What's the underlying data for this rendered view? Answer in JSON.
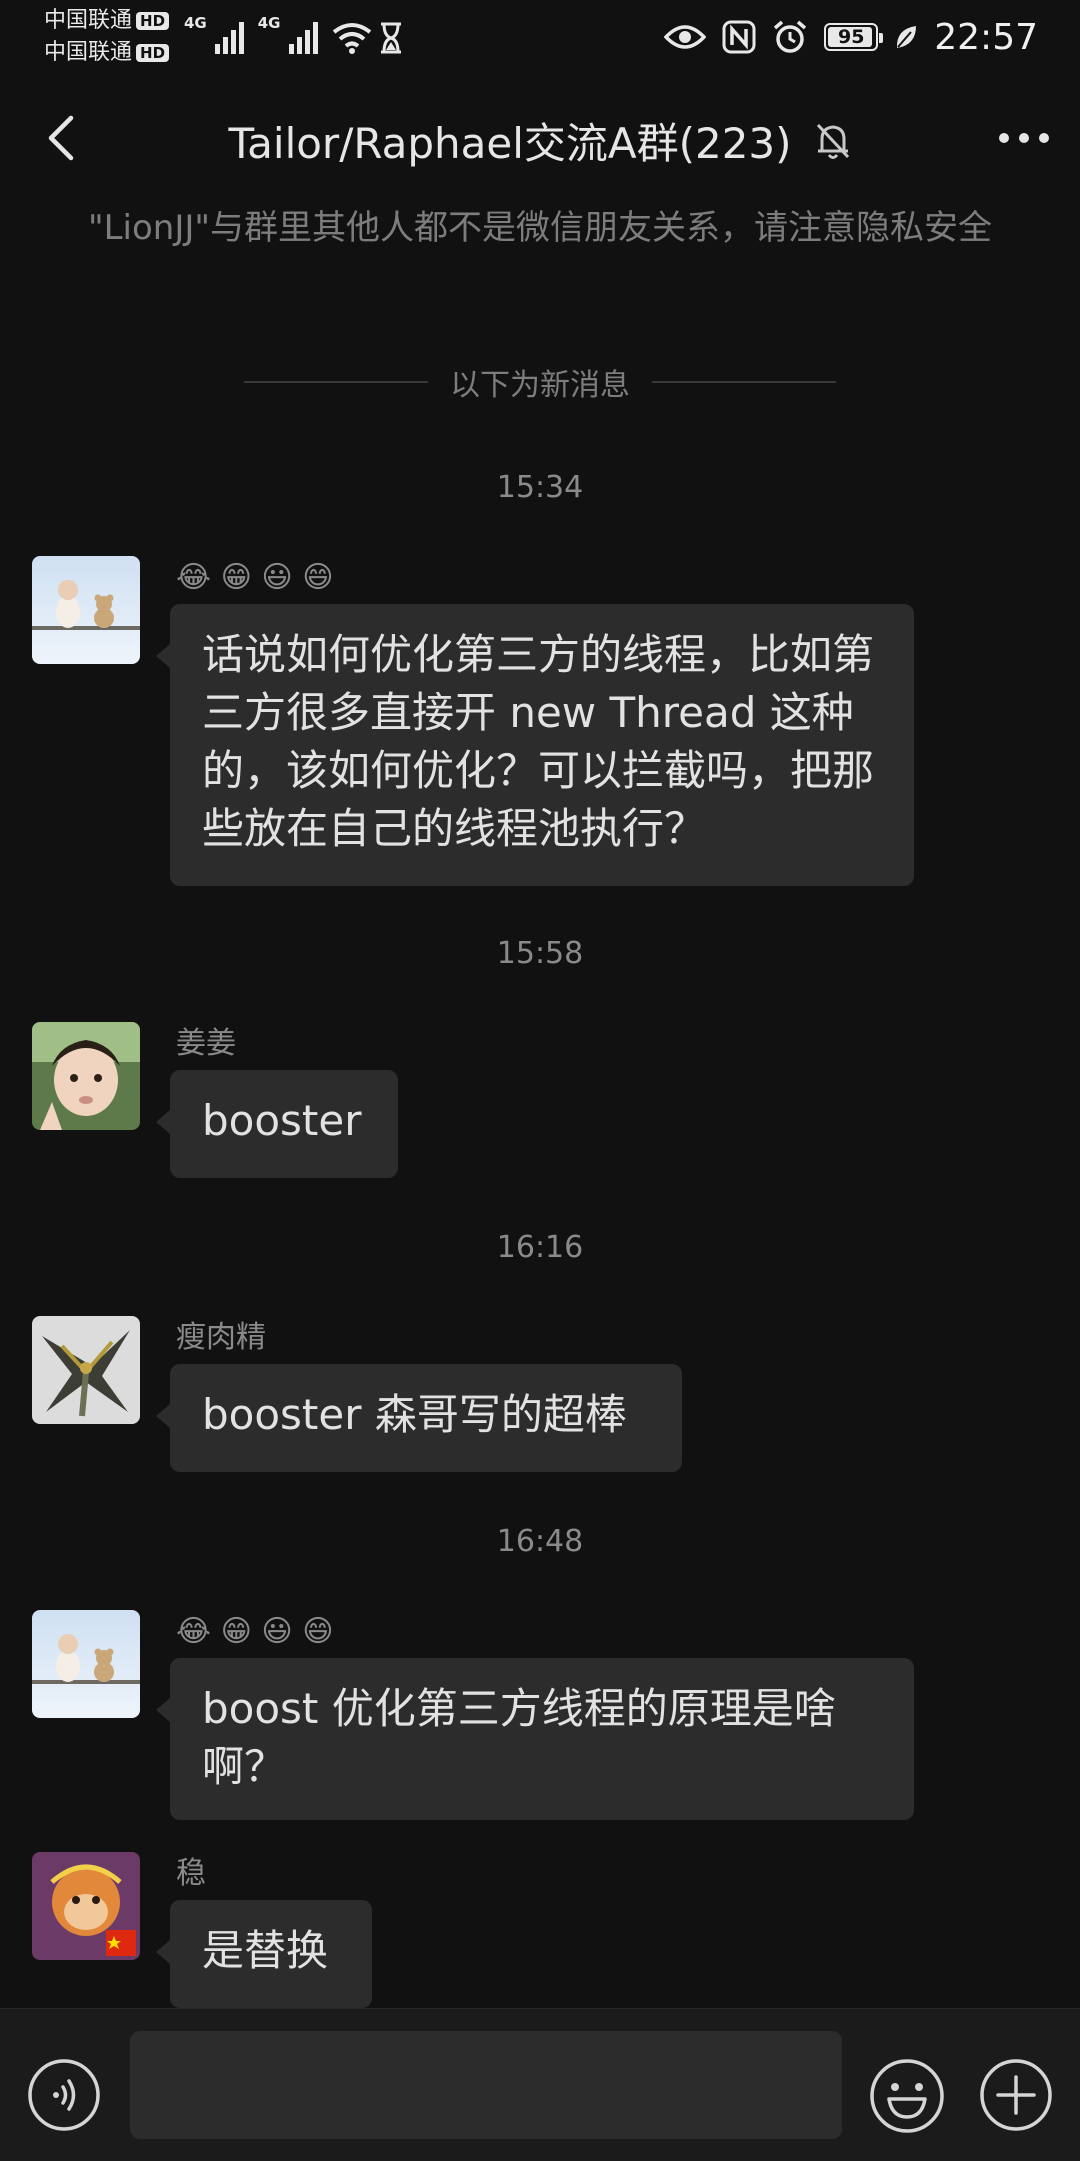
{
  "status_bar": {
    "carriers": [
      "中国联通",
      "中国联通"
    ],
    "hd_badge": "HD",
    "network_labels": [
      "4G",
      "4G"
    ],
    "battery": "95",
    "battery_level": 0.95,
    "time": "22:57",
    "icons": [
      "signal-icon",
      "wifi-icon",
      "hourglass-icon",
      "eye-icon",
      "nfc-icon",
      "alarm-icon",
      "battery-icon",
      "leaf-icon"
    ]
  },
  "header": {
    "title": "Tailor/Raphael交流A群(223)",
    "icons": [
      "back-icon",
      "mute-bell-icon",
      "more-icon"
    ]
  },
  "privacy_notice": "\"LionJJ\"与群里其他人都不是微信朋友关系，请注意隐私安全",
  "new_messages_divider": "以下为新消息",
  "timestamps": [
    "15:34",
    "15:58",
    "16:16",
    "16:48"
  ],
  "messages": [
    {
      "sender": "😂 😁 😃 😄",
      "text": "话说如何优化第三方的线程，比如第三方很多直接开 new Thread 这种的，该如何优化？可以拦截吗，把那些放在自己的线程池执行？"
    },
    {
      "sender": "姜姜",
      "text": "booster"
    },
    {
      "sender": "瘦肉精",
      "text": "booster 森哥写的超棒"
    },
    {
      "sender": "😂 😁 😃 😄",
      "text": "boost 优化第三方线程的原理是啥啊？"
    },
    {
      "sender": "稳",
      "text": "是替换"
    }
  ],
  "input_bar": {
    "placeholder": "",
    "icons": [
      "voice-icon",
      "emoji-icon",
      "plus-icon"
    ]
  },
  "colors": {
    "background": "#111111",
    "bubble": "#2c2c2c",
    "text": "#e2e2e2",
    "muted": "#8a8a8a"
  }
}
